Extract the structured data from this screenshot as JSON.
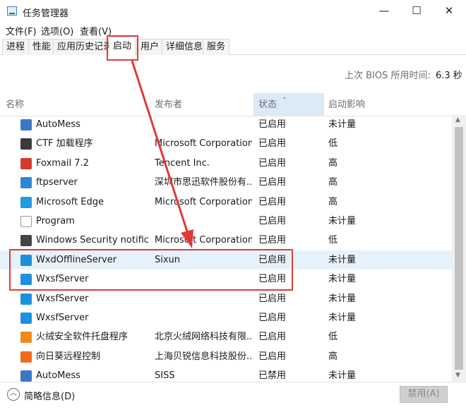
{
  "window": {
    "title": "任务管理器",
    "minimize": "—",
    "maximize": "☐",
    "close": "✕"
  },
  "menu": [
    "文件(F)",
    "选项(O)",
    "查看(V)"
  ],
  "tabs": [
    "进程",
    "性能",
    "应用历史记录",
    "启动",
    "用户",
    "详细信息",
    "服务"
  ],
  "active_tab": "启动",
  "bios": {
    "label": "上次 BIOS 所用时间:",
    "value": "6.3 秒"
  },
  "columns": {
    "name": "名称",
    "publisher": "发布者",
    "status": "状态",
    "impact": "启动影响"
  },
  "rows": [
    {
      "name": "AutoMess",
      "publisher": "",
      "status": "已启用",
      "impact": "未计量",
      "icon": "app-window-icon",
      "color": "#3b78c4"
    },
    {
      "name": "CTF 加载程序",
      "publisher": "Microsoft Corporation",
      "status": "已启用",
      "impact": "低",
      "icon": "ctf-pen-icon",
      "color": "#3a3a3a"
    },
    {
      "name": "Foxmail 7.2",
      "publisher": "Tencent Inc.",
      "status": "已启用",
      "impact": "高",
      "icon": "foxmail-icon",
      "color": "#d43b2f"
    },
    {
      "name": "ftpserver",
      "publisher": "深圳市思迅软件股份有...",
      "status": "已启用",
      "impact": "高",
      "icon": "ftp-server-icon",
      "color": "#2b86d9"
    },
    {
      "name": "Microsoft Edge",
      "publisher": "Microsoft Corporation",
      "status": "已启用",
      "impact": "高",
      "icon": "edge-icon",
      "color": "#1f9be0"
    },
    {
      "name": "Program",
      "publisher": "",
      "status": "已启用",
      "impact": "未计量",
      "icon": "blank-document-icon",
      "color": "#ffffff"
    },
    {
      "name": "Windows Security notifica...",
      "publisher": "Microsoft Corporation",
      "status": "已启用",
      "impact": "低",
      "icon": "shield-icon",
      "color": "#444444"
    },
    {
      "name": "WxdOfflineServer",
      "publisher": "Sixun",
      "status": "已启用",
      "impact": "未计量",
      "icon": "wxd-offline-icon",
      "color": "#1e8fd8"
    },
    {
      "name": "WxsfServer",
      "publisher": "",
      "status": "已启用",
      "impact": "未计量",
      "icon": "wxsf-cart-icon",
      "color": "#1e90e0"
    },
    {
      "name": "WxsfServer",
      "publisher": "",
      "status": "已启用",
      "impact": "未计量",
      "icon": "wxsf-cart-icon",
      "color": "#1e90e0"
    },
    {
      "name": "WxsfServer",
      "publisher": "",
      "status": "已启用",
      "impact": "未计量",
      "icon": "wxsf-cart-icon",
      "color": "#1e90e0"
    },
    {
      "name": "火绒安全软件托盘程序",
      "publisher": "北京火绒网络科技有限...",
      "status": "已启用",
      "impact": "低",
      "icon": "huorong-flame-icon",
      "color": "#f08a1d"
    },
    {
      "name": "向日葵远程控制",
      "publisher": "上海贝锐信息科技股份...",
      "status": "已启用",
      "impact": "高",
      "icon": "sunflower-icon",
      "color": "#f26a1f"
    },
    {
      "name": "AutoMess",
      "publisher": "SISS",
      "status": "已禁用",
      "impact": "未计量",
      "icon": "app-window-icon",
      "color": "#3b78c4"
    }
  ],
  "footer": {
    "fewer_details": "简略信息(D)",
    "disable_button": "禁用(A)"
  }
}
